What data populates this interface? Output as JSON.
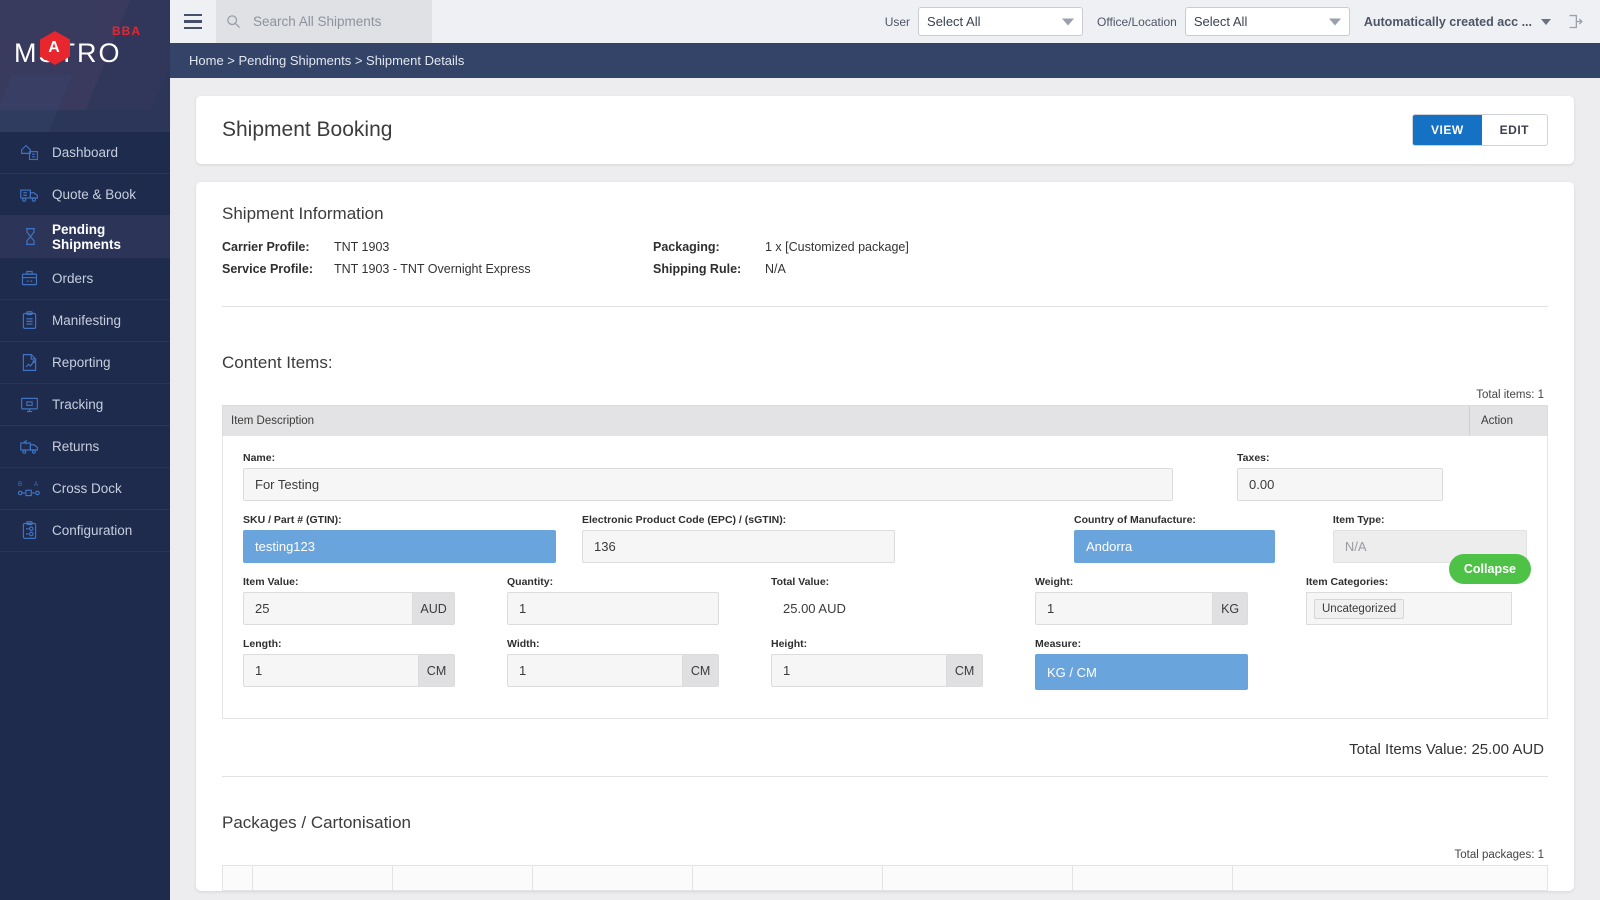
{
  "brand": {
    "logo_text": "MSTRO",
    "logo_hex_letter": "A",
    "logo_superscript": "BBA"
  },
  "sidebar": {
    "items": [
      {
        "label": "Dashboard",
        "icon": "dashboard-icon",
        "active": false
      },
      {
        "label": "Quote & Book",
        "icon": "truck-icon",
        "active": false
      },
      {
        "label": "Pending Shipments",
        "icon": "hourglass-icon",
        "active": true
      },
      {
        "label": "Orders",
        "icon": "box-icon",
        "active": false
      },
      {
        "label": "Manifesting",
        "icon": "clipboard-list-icon",
        "active": false
      },
      {
        "label": "Reporting",
        "icon": "chart-document-icon",
        "active": false
      },
      {
        "label": "Tracking",
        "icon": "monitor-icon",
        "active": false
      },
      {
        "label": "Returns",
        "icon": "return-truck-icon",
        "active": false
      },
      {
        "label": "Cross Dock",
        "icon": "cross-dock-icon",
        "active": false
      },
      {
        "label": "Configuration",
        "icon": "clipboard-gear-icon",
        "active": false
      }
    ]
  },
  "topbar": {
    "search": {
      "placeholder": "Search All Shipments",
      "value": ""
    },
    "user_label": "User",
    "user_value": "Select All",
    "office_label": "Office/Location",
    "office_value": "Select All",
    "account": "Automatically created acc ..."
  },
  "breadcrumb": "Home > Pending Shipments > Shipment Details",
  "page": {
    "title": "Shipment Booking",
    "view_label": "VIEW",
    "edit_label": "EDIT"
  },
  "shipment_information": {
    "heading": "Shipment Information",
    "left": [
      {
        "key": "Carrier Profile:",
        "value": "TNT 1903"
      },
      {
        "key": "Service Profile:",
        "value": "TNT 1903 - TNT Overnight Express"
      }
    ],
    "right": [
      {
        "key": "Packaging:",
        "value": "1 x [Customized package]"
      },
      {
        "key": "Shipping Rule:",
        "value": "N/A"
      }
    ]
  },
  "content_items": {
    "heading": "Content Items:",
    "total_items": "Total items: 1",
    "columns": {
      "description": "Item Description",
      "action": "Action"
    },
    "collapse_label": "Collapse",
    "fields": {
      "name_label": "Name:",
      "name_value": "For Testing",
      "taxes_label": "Taxes:",
      "taxes_value": "0.00",
      "sku_label": "SKU / Part # (GTIN):",
      "sku_value": "testing123",
      "epc_label": "Electronic Product Code (EPC) / (sGTIN):",
      "epc_value": "136",
      "country_label": "Country of Manufacture:",
      "country_value": "Andorra",
      "item_type_label": "Item Type:",
      "item_type_value": "N/A",
      "item_value_label": "Item Value:",
      "item_value_value": "25",
      "item_value_unit": "AUD",
      "quantity_label": "Quantity:",
      "quantity_value": "1",
      "total_value_label": "Total Value:",
      "total_value_value": "25.00 AUD",
      "weight_label": "Weight:",
      "weight_value": "1",
      "weight_unit": "KG",
      "item_categories_label": "Item Categories:",
      "item_categories_chip": "Uncategorized",
      "length_label": "Length:",
      "length_value": "1",
      "length_unit": "CM",
      "width_label": "Width:",
      "width_value": "1",
      "width_unit": "CM",
      "height_label": "Height:",
      "height_value": "1",
      "height_unit": "CM",
      "measure_label": "Measure:",
      "measure_value": "KG / CM"
    },
    "total_items_value": "Total Items Value: 25.00 AUD"
  },
  "packages": {
    "heading": "Packages / Cartonisation",
    "total_packages": "Total packages: 1"
  },
  "colors": {
    "sidebar_bg": "#1f2b4d",
    "breadcrumb_bg": "#344469",
    "accent_blue": "#1471c4",
    "selected_field": "#6aa4dc",
    "collapse_green": "#4dc247",
    "logo_red": "#e8262d"
  }
}
